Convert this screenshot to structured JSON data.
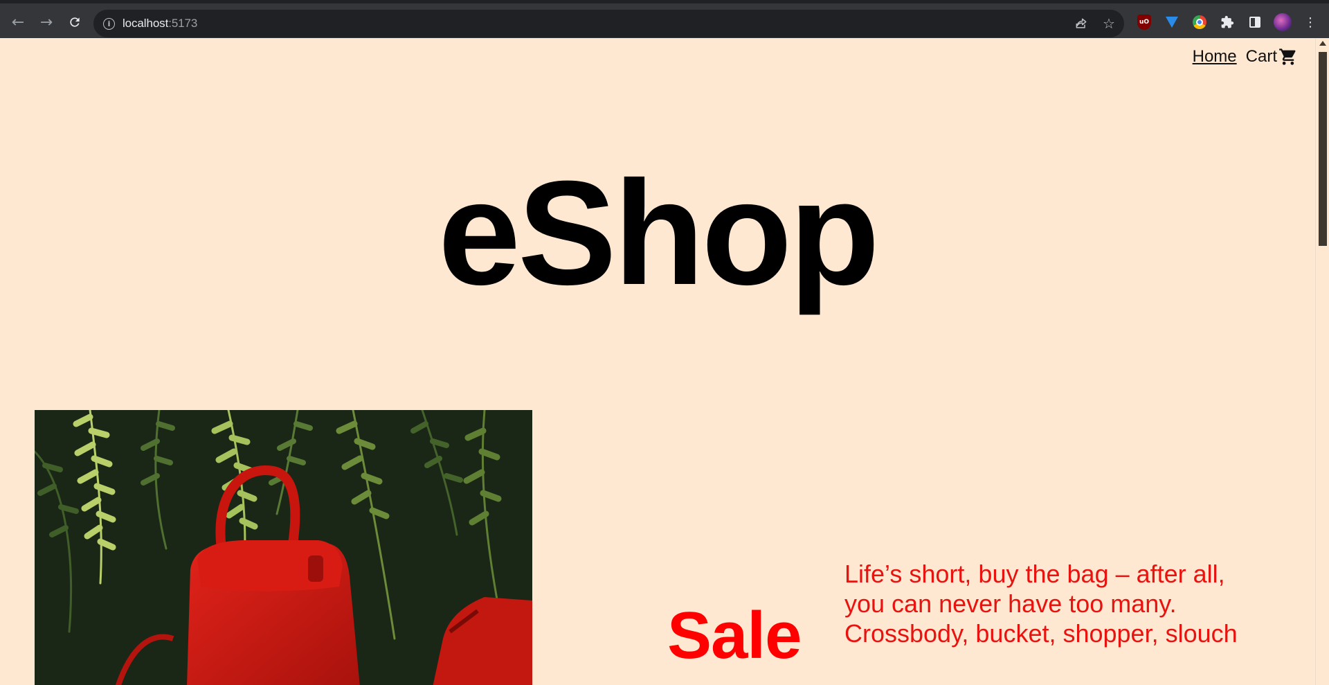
{
  "browser": {
    "url_host": "localhost",
    "url_port": ":5173"
  },
  "nav": {
    "home_label": "Home",
    "cart_label": "Cart"
  },
  "hero": {
    "title": "eShop"
  },
  "sale": {
    "heading": "Sale",
    "description": "Life’s short, buy the bag – after all, you can never have too many. Crossbody, bucket, shopper, slouch"
  },
  "colors": {
    "page_bg": "#ffe8d2",
    "sale_red": "#ff0000"
  },
  "icons": {
    "back": "arrow-left-icon",
    "forward": "arrow-right-icon",
    "reload": "reload-icon",
    "info": "info-icon",
    "share": "share-icon",
    "bookmark": "star-icon",
    "cart": "shopping-cart-icon"
  }
}
